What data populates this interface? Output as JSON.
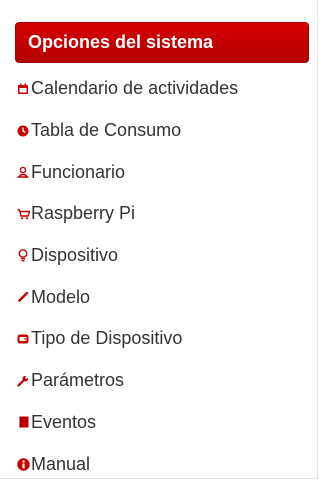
{
  "sidebar": {
    "title": "Opciones del sistema",
    "items": [
      {
        "label": "Calendario de actividades",
        "icon": "calendar-icon"
      },
      {
        "label": "Tabla de Consumo",
        "icon": "clock-icon"
      },
      {
        "label": "Funcionario",
        "icon": "user-icon"
      },
      {
        "label": "Raspberry Pi",
        "icon": "cart-icon"
      },
      {
        "label": "Dispositivo",
        "icon": "lightbulb-icon"
      },
      {
        "label": "Modelo",
        "icon": "pencil-icon"
      },
      {
        "label": "Tipo de Dispositivo",
        "icon": "hdd-icon"
      },
      {
        "label": "Parámetros",
        "icon": "wrench-icon"
      },
      {
        "label": "Eventos",
        "icon": "book-icon"
      },
      {
        "label": "Manual",
        "icon": "info-icon"
      }
    ]
  },
  "colors": {
    "accent": "#c40000",
    "text": "#333333"
  }
}
